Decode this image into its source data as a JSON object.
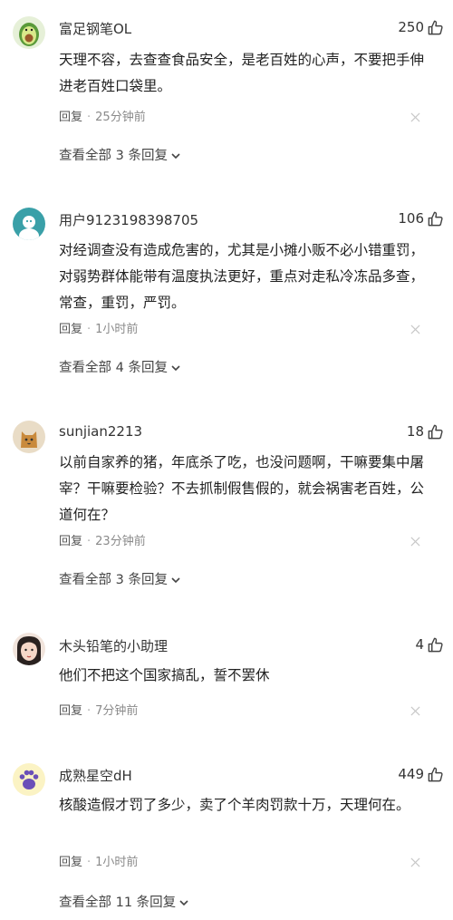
{
  "comments": [
    {
      "username": "富足钢笔OL",
      "likes": "250",
      "text": "天理不容，去查查食品安全，是老百姓的心声，不要把手伸进老百姓口袋里。",
      "reply_label": "回复",
      "time": "25分钟前",
      "view_all_text": "查看全部 3 条回复",
      "avatar_icon": "avocado-avatar",
      "avatar_bg": "#e6f0d8"
    },
    {
      "username": "用户9123198398705",
      "likes": "106",
      "text": "对经调查没有造成危害的，尤其是小摊小贩不必小错重罚，对弱势群体能带有温度执法更好，重点对走私冷冻品多查，常查，重罚，严罚。",
      "reply_label": "回复",
      "time": "1小时前",
      "view_all_text": "查看全部 4 条回复",
      "avatar_icon": "default-user-avatar",
      "avatar_bg": "#3aa0a8"
    },
    {
      "username": "sunjian2213",
      "likes": "18",
      "text": "以前自家养的猪，年底杀了吃，也没问题啊，干嘛要集中屠宰？干嘛要检验？不去抓制假售假的，就会祸害老百姓，公道何在？",
      "reply_label": "回复",
      "time": "23分钟前",
      "view_all_text": "查看全部 3 条回复",
      "avatar_icon": "cat-avatar",
      "avatar_bg": "#e9dcc6"
    },
    {
      "username": "木头铅笔的小助理",
      "likes": "4",
      "text": "他们不把这个国家搞乱，誓不罢休",
      "reply_label": "回复",
      "time": "7分钟前",
      "view_all_text": "",
      "avatar_icon": "girl-photo-avatar",
      "avatar_bg": "#f1e4dc"
    },
    {
      "username": "成熟星空dH",
      "likes": "449",
      "text": "核酸造假才罚了多少，卖了个羊肉罚款十万，天理何在。",
      "reply_label": "回复",
      "time": "1小时前",
      "view_all_text": "查看全部 11 条回复",
      "avatar_icon": "paw-avatar",
      "avatar_bg": "#fbf3c4"
    }
  ]
}
